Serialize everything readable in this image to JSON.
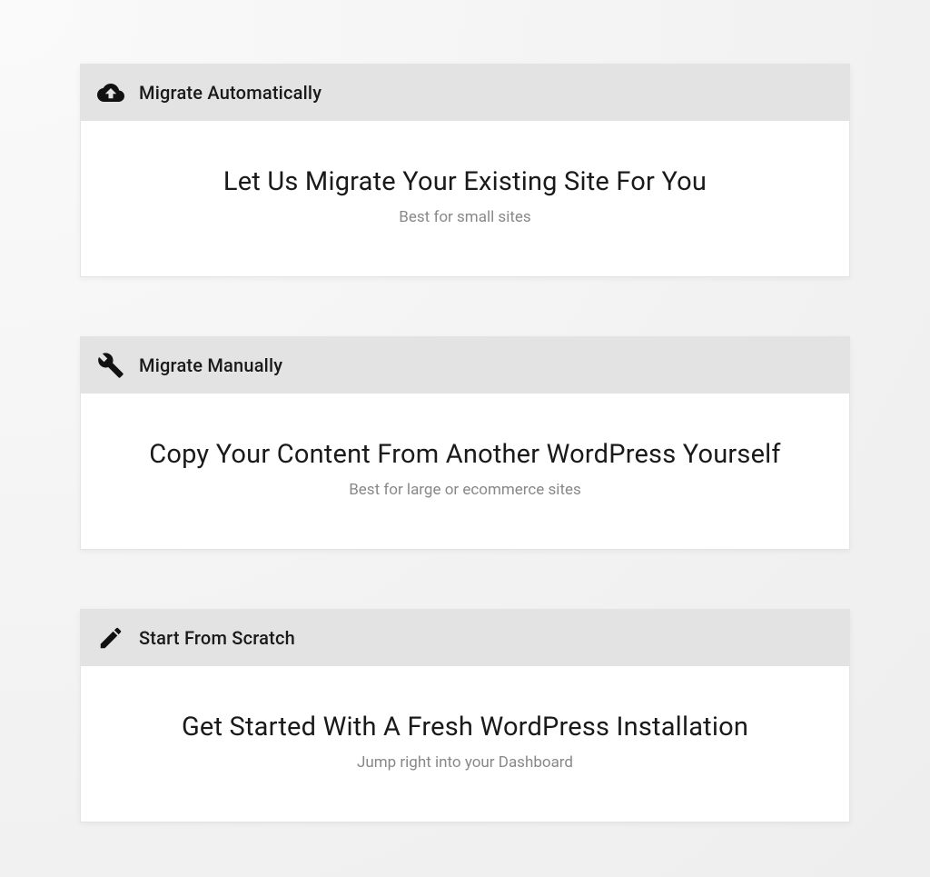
{
  "options": [
    {
      "icon": "cloud-upload-icon",
      "header": "Migrate Automatically",
      "title": "Let Us Migrate Your Existing Site For You",
      "subtitle": "Best for small sites"
    },
    {
      "icon": "wrench-icon",
      "header": "Migrate Manually",
      "title": "Copy Your Content From Another WordPress Yourself",
      "subtitle": "Best for large or ecommerce sites"
    },
    {
      "icon": "pencil-icon",
      "header": "Start From Scratch",
      "title": "Get Started With A Fresh WordPress Installation",
      "subtitle": "Jump right into your Dashboard"
    }
  ]
}
